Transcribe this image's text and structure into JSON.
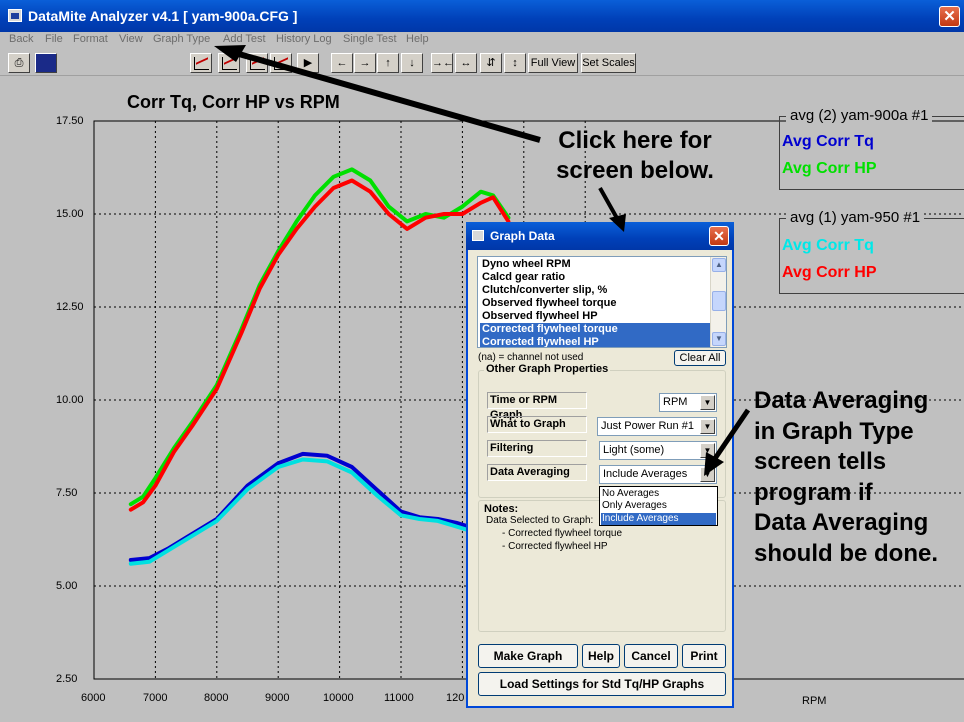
{
  "window": {
    "title": "DataMite Analyzer v4.1  [ yam-900a.CFG ]",
    "close_glyph": "✕"
  },
  "menu": [
    "Back",
    "File",
    "Format",
    "View",
    "Graph Type",
    "Add Test",
    "History Log",
    "Single Test",
    "Help"
  ],
  "toolbar": {
    "arrows": [
      "←",
      "→",
      "↑",
      "↓",
      "→←",
      "↔",
      "⇵",
      "↕"
    ],
    "full_view": "Full View",
    "set_scales": "Set Scales"
  },
  "chart_data": {
    "type": "line",
    "title": "Corr Tq, Corr HP vs RPM",
    "xlabel": "RPM",
    "xlim": [
      6000,
      12500
    ],
    "ylim": [
      2.5,
      17.5
    ],
    "x_ticks": [
      "6000",
      "7000",
      "8000",
      "9000",
      "10000",
      "11000",
      "120"
    ],
    "y_ticks": [
      "17.50",
      "15.00",
      "12.50",
      "10.00",
      "7.50",
      "5.00",
      "2.50"
    ],
    "grid": true,
    "series": [
      {
        "name": "Avg Corr HP",
        "color": "#00e000",
        "x": [
          6600,
          6800,
          7000,
          7300,
          7600,
          8000,
          8400,
          8700,
          9000,
          9300,
          9600,
          9900,
          10200,
          10500,
          10800,
          11100,
          11400,
          11700,
          12000,
          12300,
          12500,
          12750
        ],
        "y": [
          7.2,
          7.4,
          7.9,
          8.7,
          9.4,
          10.4,
          11.9,
          13.1,
          14.0,
          14.8,
          15.5,
          16.0,
          16.2,
          15.9,
          15.2,
          14.8,
          15.0,
          14.9,
          15.2,
          15.6,
          15.5,
          14.9
        ]
      },
      {
        "name": "Avg Corr HP",
        "color": "#ff0000",
        "x": [
          6600,
          6800,
          7000,
          7300,
          7600,
          8000,
          8400,
          8700,
          9000,
          9300,
          9600,
          9900,
          10200,
          10500,
          10800,
          11100,
          11400,
          11700,
          12000,
          12300,
          12500,
          12750
        ],
        "y": [
          7.05,
          7.25,
          7.7,
          8.6,
          9.3,
          10.3,
          11.8,
          13.0,
          13.9,
          14.6,
          15.2,
          15.7,
          15.9,
          15.6,
          15.0,
          14.6,
          14.9,
          15.0,
          15.0,
          15.3,
          15.45,
          14.8
        ]
      },
      {
        "name": "Avg Corr Tq",
        "color": "#0000d0",
        "x": [
          6600,
          6900,
          7200,
          7500,
          8000,
          8500,
          9000,
          9400,
          9800,
          10200,
          10600,
          11000,
          11300,
          11600,
          11900,
          12100
        ],
        "y": [
          5.7,
          5.75,
          6.0,
          6.3,
          6.8,
          7.7,
          8.3,
          8.55,
          8.5,
          8.2,
          7.6,
          7.0,
          6.85,
          6.8,
          6.7,
          6.6
        ]
      },
      {
        "name": "Avg Corr Tq",
        "color": "#00e0e0",
        "x": [
          6600,
          6900,
          7200,
          7500,
          8000,
          8500,
          9000,
          9400,
          9800,
          10200,
          10600,
          11000,
          11300,
          11600,
          11900,
          12100
        ],
        "y": [
          5.6,
          5.65,
          5.95,
          6.25,
          6.75,
          7.6,
          8.2,
          8.4,
          8.35,
          8.05,
          7.45,
          6.9,
          6.8,
          6.75,
          6.6,
          6.5
        ]
      }
    ]
  },
  "legend": [
    {
      "header": "avg (2) yam-900a   #1",
      "items": [
        {
          "label": "Avg Corr Tq",
          "color": "#0000d0"
        },
        {
          "label": "Avg Corr HP",
          "color": "#00e000"
        }
      ]
    },
    {
      "header": "avg (1) yam-950   #1",
      "items": [
        {
          "label": "Avg Corr Tq",
          "color": "#00e8e8"
        },
        {
          "label": "Avg Corr HP",
          "color": "#ff0000"
        }
      ]
    }
  ],
  "annotations": {
    "click_here": [
      "Click here for",
      "screen below."
    ],
    "data_averaging": [
      "Data Averaging",
      "in Graph Type",
      "screen tells",
      "program if",
      "Data Averaging",
      "should be done."
    ]
  },
  "dialog": {
    "title": "Graph Data",
    "close_glyph": "✕",
    "channels": [
      {
        "label": "Dyno wheel RPM",
        "selected": false
      },
      {
        "label": "Calcd gear ratio",
        "selected": false
      },
      {
        "label": "Clutch/converter slip, %",
        "selected": false
      },
      {
        "label": "Observed flywheel torque",
        "selected": false
      },
      {
        "label": "Observed flywheel HP",
        "selected": false
      },
      {
        "label": "Corrected flywheel torque",
        "selected": true
      },
      {
        "label": "Corrected flywheel HP",
        "selected": true
      }
    ],
    "na_note": "(na) = channel not used",
    "clear_all": "Clear All",
    "other_props_label": "Other Graph Properties",
    "props": {
      "time_rpm": {
        "label": "Time or RPM Graph",
        "value": "RPM"
      },
      "what_to_graph": {
        "label": "What to Graph",
        "value": "Just Power Run #1"
      },
      "filtering": {
        "label": "Filtering",
        "value": "Light (some)"
      },
      "data_averaging": {
        "label": "Data Averaging",
        "value": "Include Averages"
      }
    },
    "averaging_options": [
      {
        "label": "No Averages",
        "selected": false
      },
      {
        "label": "Only Averages",
        "selected": false
      },
      {
        "label": "Include Averages",
        "selected": true
      }
    ],
    "notes_label": "Notes:",
    "notes_lines": [
      "Data Selected to Graph:",
      "- Corrected flywheel torque",
      "- Corrected flywheel HP"
    ],
    "buttons": {
      "make_graph": "Make Graph",
      "help": "Help",
      "cancel": "Cancel",
      "print": "Print",
      "load_settings": "Load Settings for Std Tq/HP Graphs"
    }
  }
}
